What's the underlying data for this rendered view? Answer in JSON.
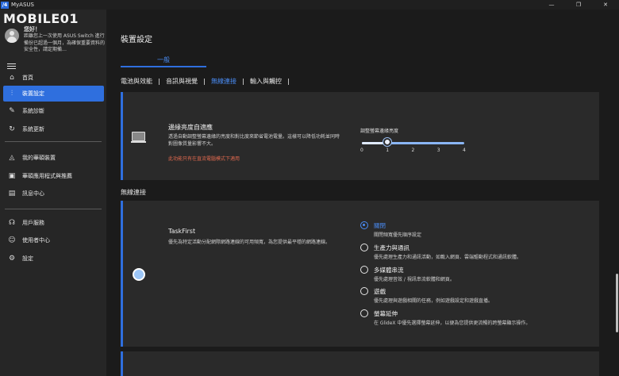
{
  "window": {
    "logo": "/4",
    "title": "MyASUS",
    "controls": [
      "—",
      "❐",
      "✕"
    ]
  },
  "watermark": {
    "text": "MOBILE01"
  },
  "user": {
    "greeting": "您好！",
    "notice": "距離您上一次使用 ASUS Switch 進行備份已超過一個月，為確保重要資料的安全性，請定期備…"
  },
  "sidebar": {
    "items": [
      {
        "label": "首頁",
        "icon": "home-icon"
      },
      {
        "label": "裝置設定",
        "icon": "sliders-icon",
        "active": true
      },
      {
        "label": "系統診斷",
        "icon": "wrench-icon"
      },
      {
        "label": "系統更新",
        "icon": "refresh-icon"
      },
      {
        "label": "我的華碩裝置",
        "icon": "device-triangle-icon"
      },
      {
        "label": "華碩應用程式與推薦",
        "icon": "apps-icon"
      },
      {
        "label": "訊息中心",
        "icon": "message-icon"
      },
      {
        "label": "用戶服務",
        "icon": "headset-icon"
      },
      {
        "label": "使用者中心",
        "icon": "user-icon"
      },
      {
        "label": "設定",
        "icon": "gear-icon"
      }
    ]
  },
  "main": {
    "title": "裝置設定",
    "tab": "一般",
    "subtabs": [
      "電池與效能",
      "音訊與視覺",
      "無線連接",
      "輸入與觸控"
    ],
    "selected_subtab": 2
  },
  "brightness_card": {
    "title": "邊緣亮度自適應",
    "description": "透過自動調整螢幕邊緣的亮度和對比度來節省電池電量。這樣可以降低功耗並同時對圖像質量影響不大。",
    "warning": "此功能只有在直流電腦模式下適用",
    "slider": {
      "label": "調整螢幕邊緣亮度",
      "ticks": [
        "0",
        "1",
        "2",
        "3",
        "4"
      ],
      "value": 1,
      "max": 4
    }
  },
  "wireless": {
    "section_label": "無線連接",
    "taskfirst": {
      "title": "TaskFirst",
      "description": "優先為特定活動分配網際網路連線的可用頻寬，為您提供最平穩的網路連線。",
      "options": [
        {
          "title": "關閉",
          "desc": "關閉頻寬優先順序設定",
          "selected": true
        },
        {
          "title": "生產力與通訊",
          "desc": "優先處理生產力和通訊活動，如載入網頁、雲端驅動程式和通訊軟體。"
        },
        {
          "title": "多媒體串流",
          "desc": "優先處理音效 / 視訊串流軟體和網頁。"
        },
        {
          "title": "遊戲",
          "desc": "優先處理與遊戲相關的任務，例如遊戲設定和遊戲直播。"
        },
        {
          "title": "螢幕延伸",
          "desc": "在 GlideX 中優先選擇螢幕延伸，以便為您提供更流暢的跨螢幕顯示操作。"
        }
      ]
    }
  }
}
